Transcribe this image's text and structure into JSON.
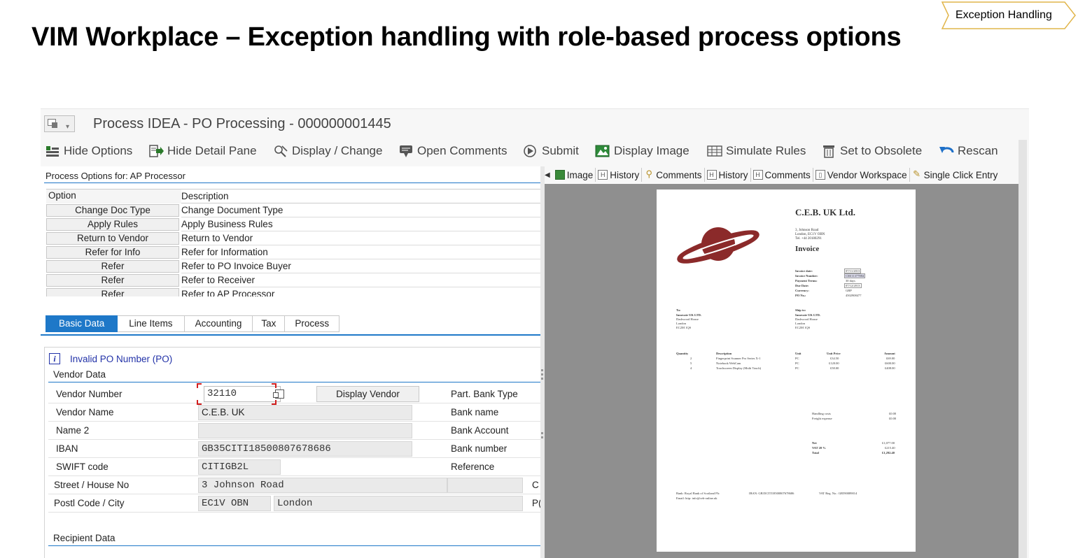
{
  "slide": {
    "title": "VIM Workplace – Exception handling with role-based process options",
    "badge": "Exception Handling"
  },
  "window": {
    "title": "Process IDEA - PO Processing - 000000001445"
  },
  "toolbar": {
    "hide_options": "Hide Options",
    "hide_detail_pane": "Hide Detail Pane",
    "display_change": "Display / Change",
    "open_comments": "Open Comments",
    "submit": "Submit",
    "display_image": "Display Image",
    "simulate_rules": "Simulate Rules",
    "set_obsolete": "Set to Obsolete",
    "rescan": "Rescan"
  },
  "process_options": {
    "heading": "Process Options for: AP Processor",
    "col_option": "Option",
    "col_description": "Description",
    "rows": [
      {
        "option": "Change Doc Type",
        "description": "Change Document Type"
      },
      {
        "option": "Apply Rules",
        "description": "Apply Business Rules"
      },
      {
        "option": "Return to Vendor",
        "description": "Return to Vendor"
      },
      {
        "option": "Refer for Info",
        "description": "Refer for Information"
      },
      {
        "option": "Refer",
        "description": "Refer to PO Invoice Buyer"
      },
      {
        "option": "Refer",
        "description": "Refer to Receiver"
      },
      {
        "option": "Refer",
        "description": "Refer to AP Processor"
      }
    ]
  },
  "tabs": [
    "Basic Data",
    "Line Items",
    "Accounting",
    "Tax",
    "Process"
  ],
  "detail": {
    "message": "Invalid PO Number (PO)",
    "vendor_section": "Vendor Data",
    "recipient_section": "Recipient Data",
    "display_vendor_button": "Display Vendor",
    "fields": {
      "vendor_number_label": "Vendor Number",
      "vendor_number": "32110",
      "vendor_name_label": "Vendor Name",
      "vendor_name": "C.E.B. UK",
      "name2_label": "Name 2",
      "name2": "",
      "iban_label": "IBAN",
      "iban": "GB35CITI18500807678686",
      "swift_label": "SWIFT code",
      "swift": "CITIGB2L",
      "street_label": "Street / House No",
      "street": "3 Johnson Road",
      "postal_label": "Postl Code / City",
      "postal_code": "EC1V OBN",
      "city": "London"
    },
    "right_labels": {
      "part_bank_type": "Part. Bank Type",
      "bank_name": "Bank name",
      "bank_account": "Bank Account",
      "bank_number": "Bank number",
      "reference": "Reference",
      "cut_c": "C",
      "cut_pc": "P("
    }
  },
  "right_tabs": [
    "Image",
    "History",
    "Comments",
    "History",
    "Comments",
    "Vendor Workspace",
    "Single Click Entry"
  ],
  "invoice": {
    "company": "C.E.B. UK Ltd.",
    "address_lines": [
      "3, Johnson Road",
      "London, EC1V OBN",
      "Tel. +44 20180291"
    ],
    "doc_type": "Invoice",
    "meta_labels": [
      "Invoice date:",
      "Invoice Number:",
      "Payment Terms:",
      "Due Date:",
      "Currency:",
      "PO No.:"
    ],
    "meta_values": [
      "07/11/2013",
      "CM/11377884",
      "30 days",
      "07/12/2013",
      "GBP",
      "4502908477"
    ],
    "to_label": "To:",
    "to_lines": [
      "Innovate UK LTD.",
      "Dashwood House",
      "London",
      "EC2M 1QS"
    ],
    "ship_label": "Ship to:",
    "ship_lines": [
      "Innovate UK LTD.",
      "Dashwood House",
      "London",
      "EC2M 1QS"
    ],
    "item_headers": [
      "Quantity",
      "Description",
      "Unit",
      "Unit Price",
      "Amount"
    ],
    "items": [
      {
        "qty": "2",
        "desc": "Fingerprint Scanner Pro Series X-1",
        "unit": "PC",
        "price": "£34.50",
        "amount": "£69.00"
      },
      {
        "qty": "5",
        "desc": "Notebook WebCam",
        "unit": "PC",
        "price": "£120.00",
        "amount": "£600.00"
      },
      {
        "qty": "4",
        "desc": "Touchscreen Display (Multi Touch)",
        "unit": "PC",
        "price": "£58.00",
        "amount": "£408.00"
      }
    ],
    "extra_labels": [
      "Handling costs",
      "Freight expense"
    ],
    "extra_values": [
      "£0.00",
      "£0.00"
    ],
    "total_labels": [
      "Net",
      "VAT 20 %",
      "Total"
    ],
    "total_values": [
      "£1,077.00",
      "£215.40",
      "£1,292.40"
    ],
    "footer_bank": "Bank:    Royal Bank of Scotland Plc",
    "footer_iban": "IBAN: GB35CITI18500807678686",
    "footer_vat": "VAT Reg. No.: GB590089014",
    "footer_email": "Email:   http: info@ceb-online.uk"
  },
  "colors": {
    "accent": "#1e78c8",
    "message_blue": "#2232a8",
    "logo_red": "#8b2a2a",
    "focus_red": "#d21f1f"
  }
}
